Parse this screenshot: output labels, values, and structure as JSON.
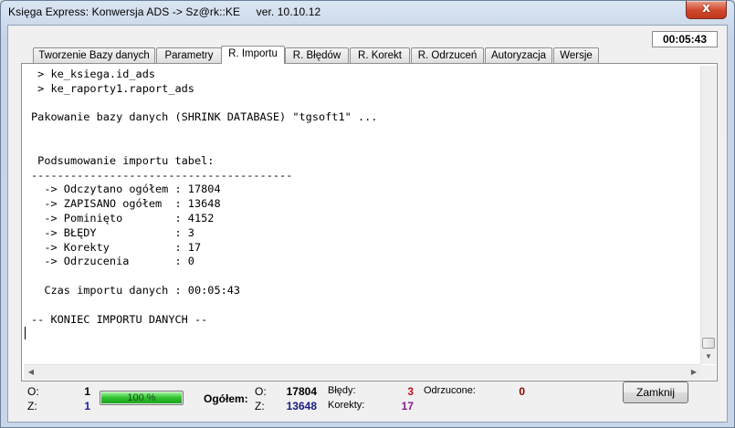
{
  "window": {
    "title": "Księga Express:   Konwersja  ADS  ->  Sz@rk::KE",
    "version": "ver. 10.10.12",
    "close_label": "x"
  },
  "timer": "00:05:43",
  "tabs": [
    {
      "label": "Tworzenie Bazy danych",
      "active": false
    },
    {
      "label": "Parametry",
      "active": false
    },
    {
      "label": "R. Importu",
      "active": true
    },
    {
      "label": "R. Błędów",
      "active": false
    },
    {
      "label": "R. Korekt",
      "active": false
    },
    {
      "label": "R. Odrzuceń",
      "active": false
    },
    {
      "label": "Autoryzacja",
      "active": false
    },
    {
      "label": "Wersje",
      "active": false
    }
  ],
  "log_lines": [
    " > ke_ksiega.id_ads",
    " > ke_raporty1.raport_ads",
    "",
    "Pakowanie bazy danych (SHRINK DATABASE) \"tgsoft1\" ...",
    "",
    "",
    " Podsumowanie importu tabel:",
    "----------------------------------------",
    "  -> Odczytano ogółem : 17804",
    "  -> ZAPISANO ogółem  : 13648",
    "  -> Pominięto        : 4152",
    "  -> BŁĘDY            : 3",
    "  -> Korekty          : 17",
    "  -> Odrzucenia       : 0",
    "",
    "  Czas importu danych : 00:05:43",
    "",
    "-- KONIEC IMPORTU DANYCH --",
    ""
  ],
  "status": {
    "o_label": "O:",
    "o_value": "1",
    "z_label": "Z:",
    "z_value": "1",
    "progress_text": "100 %",
    "progress_fraction": 1.0,
    "ogolem_label": "Ogółem:",
    "ogolem_o_label": "O:",
    "ogolem_o_value": "17804",
    "ogolem_z_label": "Z:",
    "ogolem_z_value": "13648",
    "bledy_label": "Błędy:",
    "bledy_value": "3",
    "korekty_label": "Korekty:",
    "korekty_value": "17",
    "odrzucone_label": "Odrzucone:",
    "odrzucone_value": "0",
    "close_button": "Zamknij"
  },
  "colors": {
    "z_value": "#1a1aa8",
    "ogolem_z_value": "#1a1a80",
    "bledy_value": "#c0101a",
    "korekty_value": "#8a1a8a",
    "odrzucone_value": "#8a0000"
  }
}
